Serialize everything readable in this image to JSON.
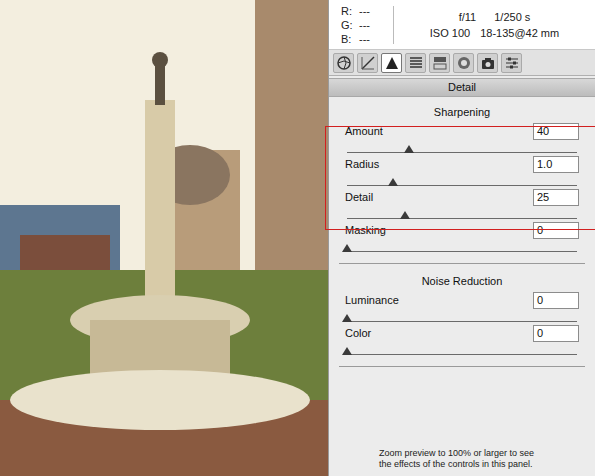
{
  "readout": {
    "r": "R:",
    "g": "G:",
    "b": "B:",
    "r_value": "---",
    "g_value": "---",
    "b_value": "---"
  },
  "camera": {
    "aperture": "f/11",
    "shutter": "1/250 s",
    "iso": "ISO 100",
    "lens": "18-135@42 mm"
  },
  "tabs": [
    {
      "selected": false
    },
    {
      "selected": false
    },
    {
      "selected": true
    },
    {
      "selected": false
    },
    {
      "selected": false
    },
    {
      "selected": false
    },
    {
      "selected": false
    },
    {
      "selected": false
    }
  ],
  "panel": {
    "title": "Detail"
  },
  "sections": [
    {
      "title": "Sharpening",
      "sliders": [
        {
          "label": "Amount",
          "value": "40",
          "level": 0.27,
          "highlighted": true
        },
        {
          "label": "Radius",
          "value": "1.0",
          "level": 0.2,
          "highlighted": true
        },
        {
          "label": "Detail",
          "value": "25",
          "level": 0.25,
          "highlighted": true
        },
        {
          "label": "Masking",
          "value": "0",
          "level": 0,
          "highlighted": false
        }
      ]
    },
    {
      "title": "Noise Reduction",
      "sliders": [
        {
          "label": "Luminance",
          "value": "0",
          "level": 0,
          "highlighted": false
        },
        {
          "label": "Color",
          "value": "0",
          "level": 0,
          "highlighted": false
        }
      ]
    }
  ],
  "hint": "Zoom preview to 100% or larger to see the effects of the controls in this panel."
}
